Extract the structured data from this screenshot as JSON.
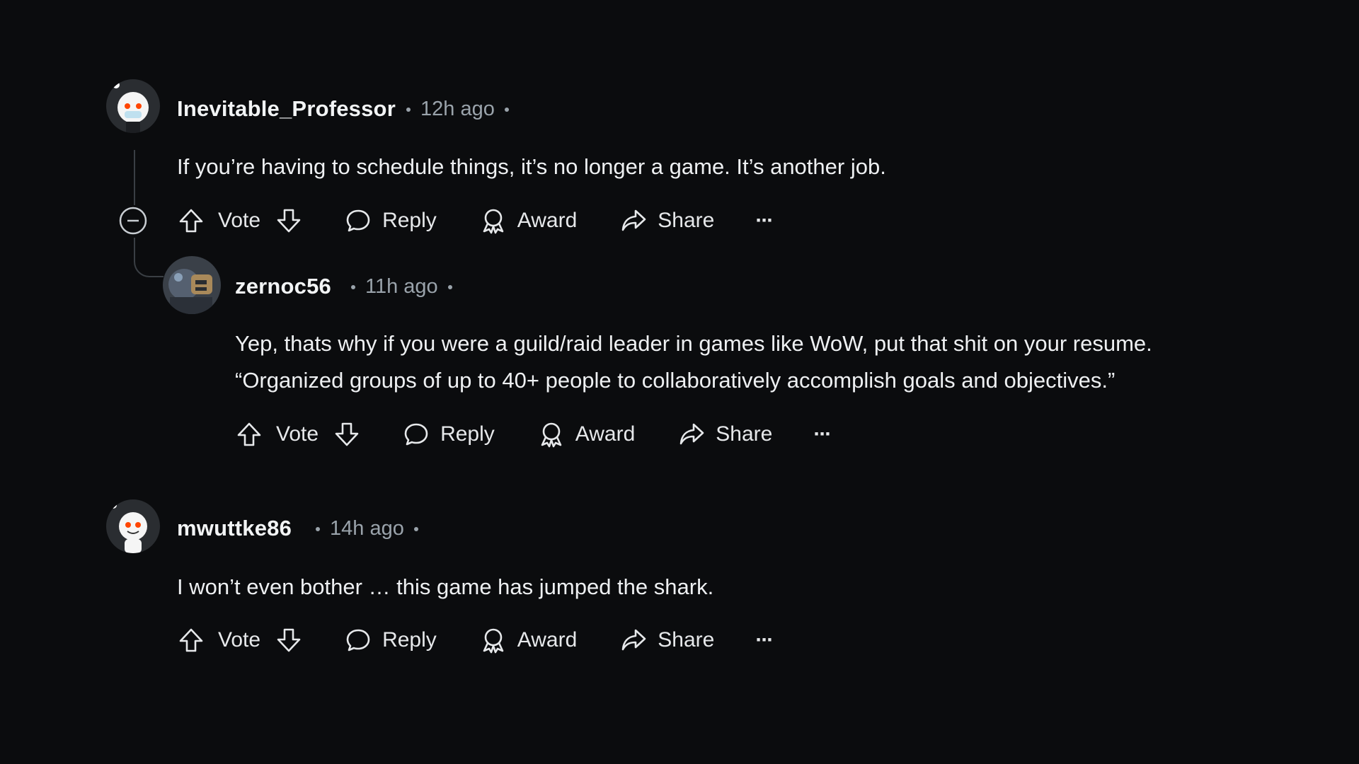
{
  "comments": [
    {
      "author": "Inevitable_Professor",
      "time": "12h ago",
      "body": "If you’re having to schedule things, it’s no longer a game. It’s another job.",
      "actions": {
        "vote": "Vote",
        "reply": "Reply",
        "award": "Award",
        "share": "Share",
        "more": "···"
      }
    },
    {
      "author": "zernoc56",
      "time": "11h ago",
      "body_lines": [
        "Yep, thats why if you were a guild/raid leader in games like WoW, put that shit on your resume.",
        "“Organized groups of up to 40+ people to collaboratively accomplish goals and objectives.”"
      ],
      "actions": {
        "vote": "Vote",
        "reply": "Reply",
        "award": "Award",
        "share": "Share",
        "more": "···"
      }
    },
    {
      "author": "mwuttke86",
      "time": "14h ago",
      "body": "I won’t even bother … this game has jumped the shark.",
      "actions": {
        "vote": "Vote",
        "reply": "Reply",
        "award": "Award",
        "share": "Share",
        "more": "···"
      }
    }
  ],
  "icons": {
    "upvote": "upvote-icon",
    "downvote": "downvote-icon",
    "reply": "reply-icon",
    "award": "award-icon",
    "share": "share-icon",
    "more": "more-icon",
    "collapse": "collapse-icon"
  },
  "colors": {
    "background": "#0b0c0e",
    "text": "#eef0f2",
    "muted": "#9aa3ab",
    "thread": "#3a3f44"
  }
}
